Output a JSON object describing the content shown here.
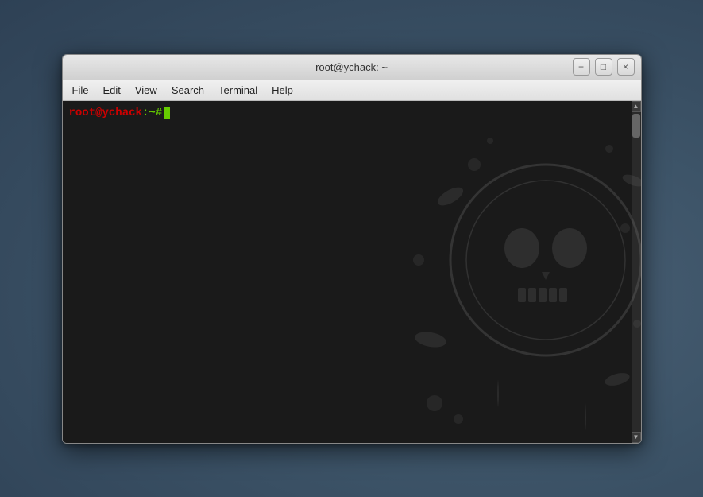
{
  "window": {
    "title": "root@ychack: ~",
    "titlebar": {
      "minimize_label": "−",
      "maximize_label": "□",
      "close_label": "×"
    },
    "menu": {
      "items": [
        "File",
        "Edit",
        "View",
        "Search",
        "Terminal",
        "Help"
      ]
    },
    "terminal": {
      "prompt_user": "root@ychack",
      "prompt_separator": ":",
      "prompt_path": "~",
      "prompt_symbol": "#"
    }
  }
}
